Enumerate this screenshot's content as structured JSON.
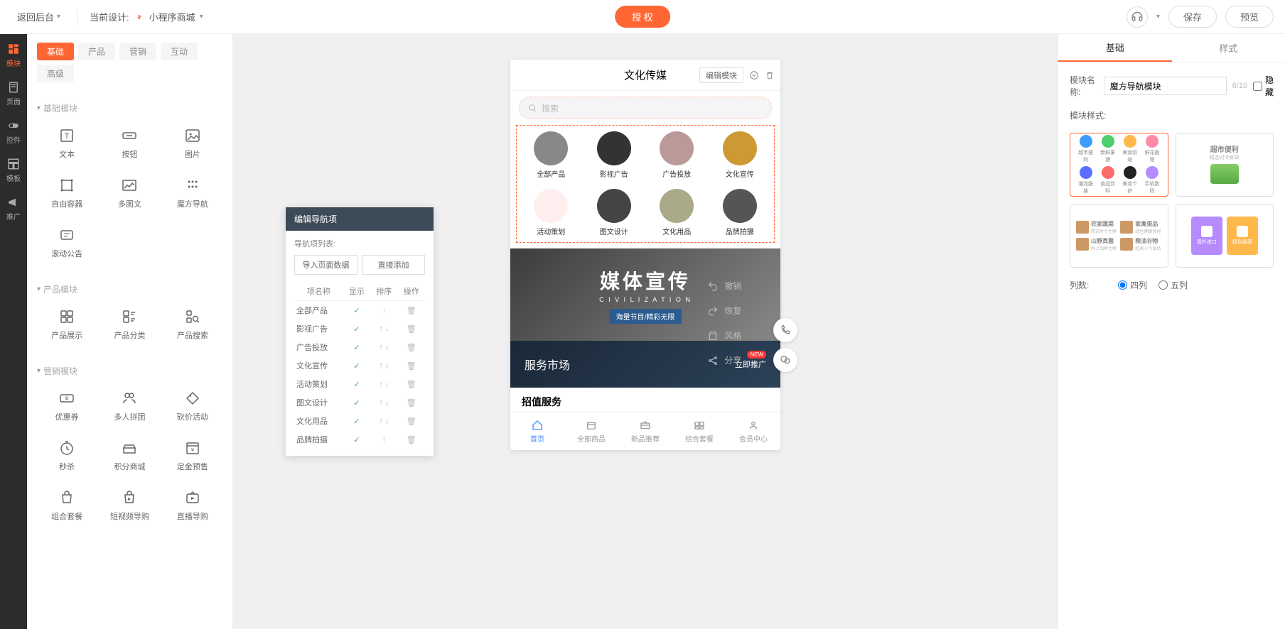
{
  "topbar": {
    "back": "返回后台",
    "current_design_label": "当前设计:",
    "design_name": "小程序商城",
    "auth": "授 权",
    "save": "保存",
    "preview": "预览"
  },
  "leftnav": [
    {
      "key": "module",
      "label": "模块",
      "active": true
    },
    {
      "key": "page",
      "label": "页面"
    },
    {
      "key": "widget",
      "label": "控件"
    },
    {
      "key": "template",
      "label": "模板"
    },
    {
      "key": "promo",
      "label": "推广"
    }
  ],
  "mod_tabs": [
    {
      "label": "基础",
      "active": true
    },
    {
      "label": "产品"
    },
    {
      "label": "营销"
    },
    {
      "label": "互动"
    },
    {
      "label": "高级"
    }
  ],
  "mod_groups": [
    {
      "title": "基础模块",
      "items": [
        {
          "label": "文本",
          "icon": "text"
        },
        {
          "label": "按钮",
          "icon": "button"
        },
        {
          "label": "图片",
          "icon": "image"
        },
        {
          "label": "自由容器",
          "icon": "container"
        },
        {
          "label": "多图文",
          "icon": "multiimg"
        },
        {
          "label": "魔方导航",
          "icon": "navgrid"
        },
        {
          "label": "滚动公告",
          "icon": "notice"
        }
      ]
    },
    {
      "title": "产品模块",
      "items": [
        {
          "label": "产品展示",
          "icon": "prodgrid"
        },
        {
          "label": "产品分类",
          "icon": "prodcat"
        },
        {
          "label": "产品搜索",
          "icon": "prodsearch"
        }
      ]
    },
    {
      "title": "营销模块",
      "items": [
        {
          "label": "优惠券",
          "icon": "coupon"
        },
        {
          "label": "多人拼团",
          "icon": "group"
        },
        {
          "label": "砍价活动",
          "icon": "bargain"
        },
        {
          "label": "秒杀",
          "icon": "flash"
        },
        {
          "label": "积分商城",
          "icon": "points"
        },
        {
          "label": "定金预售",
          "icon": "presale"
        },
        {
          "label": "组合套餐",
          "icon": "combo"
        },
        {
          "label": "短视频导购",
          "icon": "video"
        },
        {
          "label": "直播导购",
          "icon": "live"
        }
      ]
    }
  ],
  "phone": {
    "title": "文化传媒",
    "edit_module": "编辑模块",
    "search_ph": "搜索",
    "nav_items": [
      {
        "label": "全部产品"
      },
      {
        "label": "影视广告"
      },
      {
        "label": "广告投放"
      },
      {
        "label": "文化宣传"
      },
      {
        "label": "活动策划"
      },
      {
        "label": "图文设计"
      },
      {
        "label": "文化用品"
      },
      {
        "label": "品牌拍摄"
      }
    ],
    "banner": {
      "title": "媒体宣传",
      "sub": "C I V I L I Z A T I O N",
      "tag": "海量节目/精彩无限"
    },
    "service": {
      "title": "服务市场",
      "btn": "立即推广"
    },
    "extra": "招值服务",
    "tabbar": [
      {
        "label": "首页",
        "active": true
      },
      {
        "label": "全部商品"
      },
      {
        "label": "新品推荐"
      },
      {
        "label": "组合套餐"
      },
      {
        "label": "会员中心"
      }
    ]
  },
  "nav_pop": {
    "title": "编辑导航项",
    "list_label": "导航项列表:",
    "import": "导入页面数据",
    "add": "直接添加",
    "cols": {
      "name": "项名称",
      "show": "显示",
      "sort": "排序",
      "op": "操作"
    },
    "rows": [
      {
        "name": "全部产品",
        "show": true,
        "up": false,
        "down": true
      },
      {
        "name": "影视广告",
        "show": true,
        "up": true,
        "down": true
      },
      {
        "name": "广告投放",
        "show": true,
        "up": true,
        "down": true
      },
      {
        "name": "文化宣传",
        "show": true,
        "up": true,
        "down": true
      },
      {
        "name": "活动策划",
        "show": true,
        "up": true,
        "down": true
      },
      {
        "name": "图文设计",
        "show": true,
        "up": true,
        "down": true
      },
      {
        "name": "文化用品",
        "show": true,
        "up": true,
        "down": true
      },
      {
        "name": "品牌拍摄",
        "show": true,
        "up": true,
        "down": false
      }
    ]
  },
  "cv_actions": [
    {
      "label": "撤销",
      "icon": "undo"
    },
    {
      "label": "恢复",
      "icon": "redo"
    },
    {
      "label": "风格",
      "icon": "style"
    },
    {
      "label": "分享",
      "icon": "share",
      "badge": "NEW"
    }
  ],
  "props": {
    "tabs": [
      {
        "label": "基础",
        "active": true
      },
      {
        "label": "样式"
      }
    ],
    "name_label": "模块名称:",
    "name_value": "魔方导航模块",
    "name_count": "6/10",
    "hide_label": "隐藏",
    "style_label": "模块样式:",
    "style_preview_icons": [
      {
        "color": "#3b9cff",
        "label": "超市便利"
      },
      {
        "color": "#4bd06c",
        "label": "新鲜果蔬"
      },
      {
        "color": "#ffb84b",
        "label": "美食烘焙"
      },
      {
        "color": "#ff8aa8",
        "label": "鲜花植物"
      },
      {
        "color": "#5b6fff",
        "label": "潮流服装"
      },
      {
        "color": "#ff6b6b",
        "label": "食品饮料"
      },
      {
        "color": "#222",
        "label": "美妆个护"
      },
      {
        "color": "#b58bff",
        "label": "手机数码"
      }
    ],
    "style2": {
      "title": "超市便利",
      "sub": "精选时令鲜果"
    },
    "style3_items": [
      {
        "t": "农家蔬菜",
        "s": "精选时令生鲜"
      },
      {
        "t": "家禽蛋品",
        "s": "绿色健康食材"
      },
      {
        "t": "山野真菌",
        "s": "鲜上加鲜生鲜"
      },
      {
        "t": "粮油谷物",
        "s": "超高人气食品"
      }
    ],
    "style4_items": [
      {
        "label": "国外进口"
      },
      {
        "label": "绿色果蔬"
      }
    ],
    "cols_label": "列数:",
    "cols_options": [
      {
        "label": "四列",
        "checked": true
      },
      {
        "label": "五列"
      }
    ]
  }
}
